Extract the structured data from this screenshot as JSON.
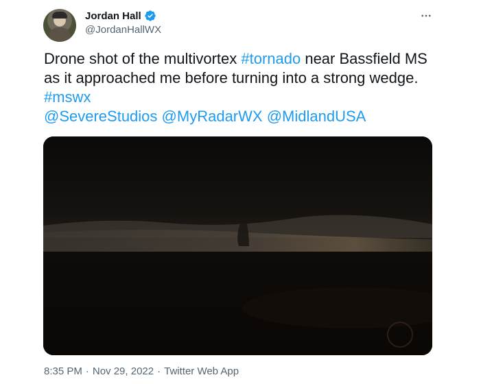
{
  "author": {
    "display_name": "Jordan Hall",
    "handle": "@JordanHallWX",
    "verified": true
  },
  "tweet": {
    "text_1": "Drone shot of the multivortex ",
    "hashtag_tornado": "#tornado",
    "text_2": " near Bassfield MS as it approached me before turning into a strong wedge. ",
    "hashtag_mswx": "#mswx",
    "mention_1": "@SevereStudios",
    "mention_2": "@MyRadarWX",
    "mention_3": "@MidlandUSA"
  },
  "meta": {
    "time": "8:35 PM",
    "date": "Nov 29, 2022",
    "source": "Twitter Web App",
    "separator": "·"
  },
  "colors": {
    "link": "#1d9bf0",
    "text": "#0f1419",
    "secondary": "#536471"
  },
  "icons": {
    "verified": "verified-badge-icon",
    "more": "more-dots-icon"
  }
}
